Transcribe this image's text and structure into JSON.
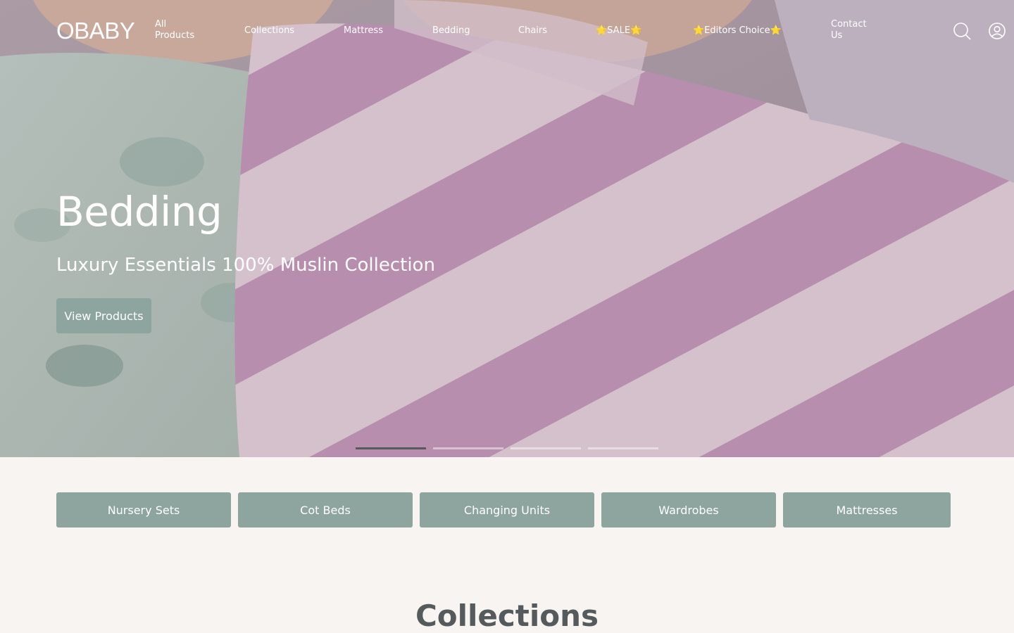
{
  "header": {
    "logo": "OBABY",
    "nav": [
      {
        "label": "All Products"
      },
      {
        "label": "Collections"
      },
      {
        "label": "Mattress"
      },
      {
        "label": "Bedding"
      },
      {
        "label": "Chairs"
      },
      {
        "label": "🌟SALE🌟"
      },
      {
        "label": "⭐Editors Choice⭐"
      },
      {
        "label": "Contact Us"
      }
    ],
    "icons": [
      "search-icon",
      "account-icon"
    ]
  },
  "hero": {
    "title": "Bedding",
    "subtitle": "Luxury Essentials 100% Muslin Collection",
    "cta": "View Products",
    "slide_count": 4,
    "active_slide": 1
  },
  "categories": [
    {
      "label": "Nursery Sets"
    },
    {
      "label": "Cot Beds"
    },
    {
      "label": "Changing Units"
    },
    {
      "label": "Wardrobes"
    },
    {
      "label": "Mattresses"
    }
  ],
  "collections_title": "Collections",
  "colors": {
    "accent": "#8ea49e",
    "background": "#f8f4f1",
    "heading": "#555a5c"
  }
}
